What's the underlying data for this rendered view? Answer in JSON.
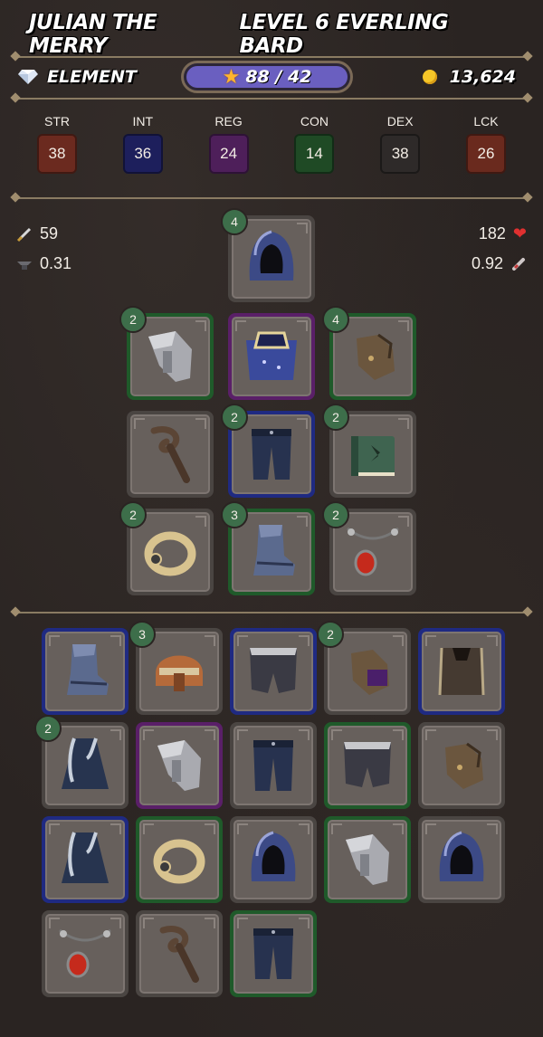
{
  "header": {
    "character_name": "Julian the Merry",
    "level_class": "Level 6 Everling Bard"
  },
  "info": {
    "element_label": "Element",
    "element_icon": "diamond-icon",
    "xp": "88 / 42",
    "xp_icon": "star-icon",
    "gold": "13,624",
    "gold_icon": "coin-icon"
  },
  "stats": [
    {
      "label": "STR",
      "value": "38",
      "color": "#6b2a1f"
    },
    {
      "label": "INT",
      "value": "36",
      "color": "#1d1f5c"
    },
    {
      "label": "REG",
      "value": "24",
      "color": "#4e1f5a"
    },
    {
      "label": "CON",
      "value": "14",
      "color": "#1f4a25"
    },
    {
      "label": "DEX",
      "value": "38",
      "color": "#2e2a29"
    },
    {
      "label": "LCK",
      "value": "26",
      "color": "#6a2a1e"
    }
  ],
  "combat": {
    "attack": "59",
    "attack_icon": "dagger-icon",
    "attack_speed": "0.31",
    "attack_speed_icon": "anvil-icon",
    "health": "182",
    "health_icon": "heart-icon",
    "regen": "0.92",
    "regen_icon": "potion-icon"
  },
  "equipped": [
    {
      "slot": "head",
      "item": "hood",
      "rarity": "none",
      "badge": "4"
    },
    {
      "slot": "shoulders",
      "item": "pauldron",
      "rarity": "green",
      "badge": "2"
    },
    {
      "slot": "chest",
      "item": "cape",
      "rarity": "purple",
      "badge": ""
    },
    {
      "slot": "hands",
      "item": "gloves",
      "rarity": "green",
      "badge": "4"
    },
    {
      "slot": "weapon",
      "item": "staff",
      "rarity": "none",
      "badge": ""
    },
    {
      "slot": "legs",
      "item": "pants",
      "rarity": "blue",
      "badge": "2"
    },
    {
      "slot": "offhand",
      "item": "book",
      "rarity": "none",
      "badge": "2"
    },
    {
      "slot": "ring",
      "item": "ring",
      "rarity": "none",
      "badge": "2"
    },
    {
      "slot": "feet",
      "item": "boot",
      "rarity": "green",
      "badge": "3"
    },
    {
      "slot": "neck",
      "item": "amulet",
      "rarity": "none",
      "badge": "2"
    }
  ],
  "inventory": [
    {
      "item": "boot",
      "rarity": "blue",
      "badge": ""
    },
    {
      "item": "helmet",
      "rarity": "none",
      "badge": "3"
    },
    {
      "item": "shorts",
      "rarity": "blue",
      "badge": ""
    },
    {
      "item": "glove-purple",
      "rarity": "none",
      "badge": "2"
    },
    {
      "item": "tunic",
      "rarity": "blue",
      "badge": ""
    },
    {
      "item": "cloak",
      "rarity": "none",
      "badge": "2"
    },
    {
      "item": "pauldron",
      "rarity": "purple",
      "badge": ""
    },
    {
      "item": "pants",
      "rarity": "none",
      "badge": ""
    },
    {
      "item": "shorts",
      "rarity": "green",
      "badge": ""
    },
    {
      "item": "gloves",
      "rarity": "none",
      "badge": ""
    },
    {
      "item": "cloak",
      "rarity": "blue",
      "badge": ""
    },
    {
      "item": "ring",
      "rarity": "green",
      "badge": ""
    },
    {
      "item": "hood",
      "rarity": "none",
      "badge": ""
    },
    {
      "item": "pauldron",
      "rarity": "green",
      "badge": ""
    },
    {
      "item": "hood",
      "rarity": "none",
      "badge": ""
    },
    {
      "item": "amulet",
      "rarity": "none",
      "badge": ""
    },
    {
      "item": "staff",
      "rarity": "none",
      "badge": ""
    },
    {
      "item": "pants",
      "rarity": "green",
      "badge": ""
    }
  ]
}
